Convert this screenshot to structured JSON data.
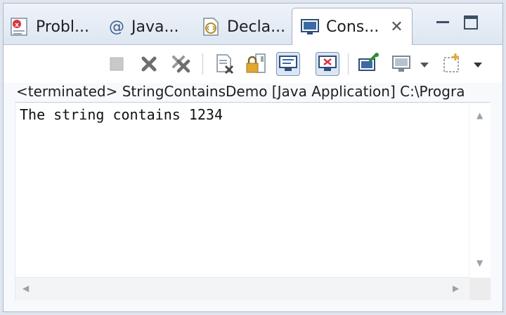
{
  "tabs": [
    {
      "label": "Probl...",
      "icon": "problems-icon"
    },
    {
      "label": "Java...",
      "icon": "javadoc-at-icon",
      "glyph": "@"
    },
    {
      "label": "Decla...",
      "icon": "declaration-icon"
    },
    {
      "label": "Cons...",
      "icon": "console-icon",
      "active": true
    }
  ],
  "window_controls": [
    "minimize-icon",
    "maximize-icon"
  ],
  "toolbar": {
    "buttons": [
      "terminate-icon",
      "remove-launch-icon",
      "remove-all-terminated-icon",
      "clear-console-icon",
      "scroll-lock-icon",
      "show-stdout-icon",
      "show-stderr-icon",
      "pin-console-icon",
      "display-console-icon",
      "open-console-icon"
    ]
  },
  "console": {
    "status": "<terminated> StringContainsDemo [Java Application] C:\\Progra",
    "output": "The string contains 1234"
  },
  "colors": {
    "accent": "#7a93b3",
    "tab_bar": "#dde6f1",
    "background": "#ffffff"
  }
}
